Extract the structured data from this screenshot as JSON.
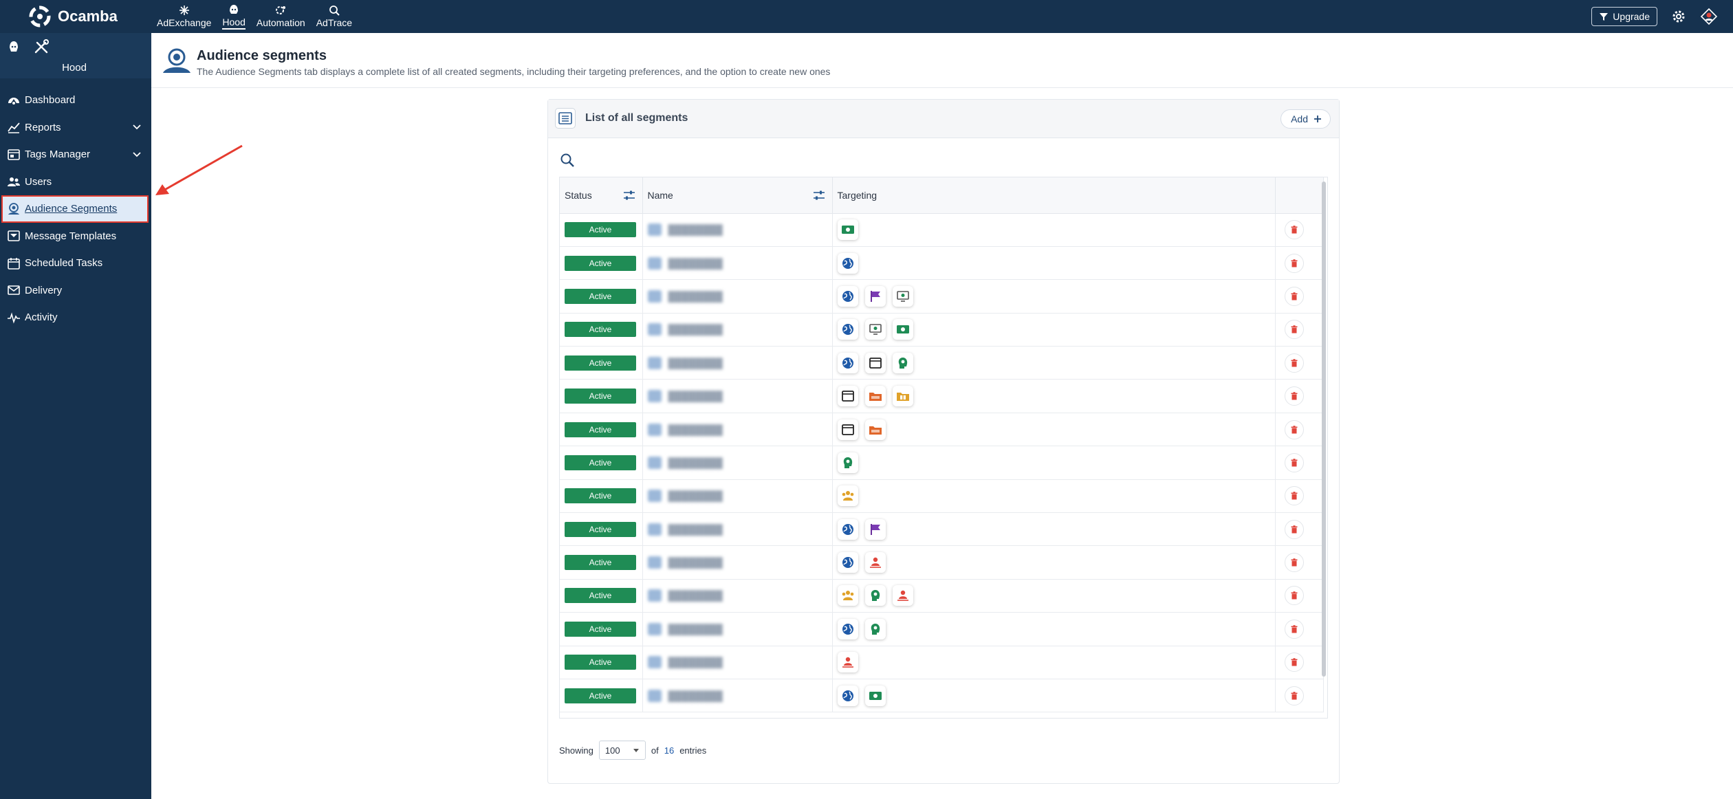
{
  "topbar": {
    "brand": "Ocamba",
    "apps": [
      {
        "label": "AdExchange",
        "icon": "sparkle-icon"
      },
      {
        "label": "Hood",
        "icon": "hood-icon",
        "active": true
      },
      {
        "label": "Automation",
        "icon": "automation-icon"
      },
      {
        "label": "AdTrace",
        "icon": "adtrace-icon"
      }
    ],
    "upgrade_label": "Upgrade"
  },
  "sidebar": {
    "title": "Hood",
    "items": [
      {
        "label": "Dashboard",
        "icon": "dashboard-icon"
      },
      {
        "label": "Reports",
        "icon": "reports-icon",
        "expandable": true
      },
      {
        "label": "Tags Manager",
        "icon": "tags-icon",
        "expandable": true
      },
      {
        "label": "Users",
        "icon": "users-icon"
      },
      {
        "label": "Audience Segments",
        "icon": "audience-icon",
        "active": true
      },
      {
        "label": "Message Templates",
        "icon": "templates-icon"
      },
      {
        "label": "Scheduled Tasks",
        "icon": "calendar-icon"
      },
      {
        "label": "Delivery",
        "icon": "delivery-icon"
      },
      {
        "label": "Activity",
        "icon": "activity-icon"
      }
    ]
  },
  "page": {
    "title": "Audience segments",
    "subtitle": "The Audience Segments tab displays a complete list of all created segments, including their targeting preferences, and the option to create new ones"
  },
  "card": {
    "title": "List of all segments",
    "add_label": "Add"
  },
  "table": {
    "columns": [
      "Status",
      "Name",
      "Targeting"
    ],
    "rows": [
      {
        "status": "Active",
        "targeting": [
          "money"
        ]
      },
      {
        "status": "Active",
        "targeting": [
          "globe"
        ]
      },
      {
        "status": "Active",
        "targeting": [
          "globe",
          "flag",
          "monitor"
        ]
      },
      {
        "status": "Active",
        "targeting": [
          "globe",
          "monitor",
          "money"
        ]
      },
      {
        "status": "Active",
        "targeting": [
          "globe",
          "window",
          "head"
        ]
      },
      {
        "status": "Active",
        "targeting": [
          "window",
          "folder",
          "folder-gift"
        ]
      },
      {
        "status": "Active",
        "targeting": [
          "window",
          "folder"
        ]
      },
      {
        "status": "Active",
        "targeting": [
          "head"
        ]
      },
      {
        "status": "Active",
        "targeting": [
          "group"
        ]
      },
      {
        "status": "Active",
        "targeting": [
          "globe",
          "flag"
        ]
      },
      {
        "status": "Active",
        "targeting": [
          "globe",
          "person"
        ]
      },
      {
        "status": "Active",
        "targeting": [
          "group",
          "head",
          "person"
        ]
      },
      {
        "status": "Active",
        "targeting": [
          "globe",
          "head"
        ]
      },
      {
        "status": "Active",
        "targeting": [
          "person"
        ]
      },
      {
        "status": "Active",
        "targeting": [
          "globe",
          "money"
        ]
      }
    ]
  },
  "footer": {
    "showing_label": "Showing",
    "page_size": "100",
    "of_label": "of",
    "total": "16",
    "entries_label": "entries"
  },
  "colors": {
    "navy": "#16324f",
    "active_green": "#1f8c55",
    "delete_red": "#e0463c",
    "highlight_red": "#e53b2f"
  }
}
